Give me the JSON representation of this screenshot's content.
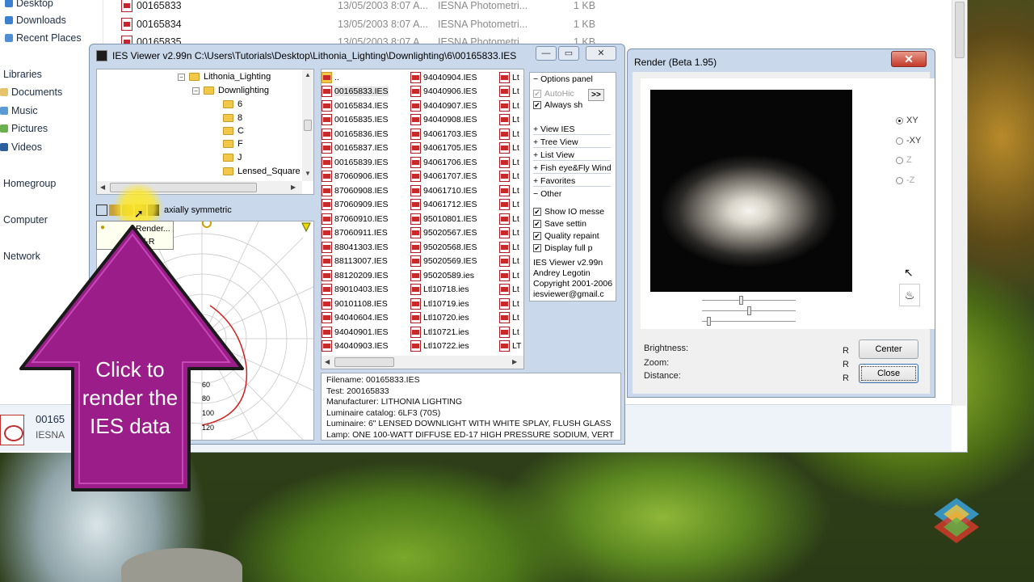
{
  "explorer": {
    "nav": [
      {
        "label": "Desktop",
        "icon": "desktop-icon"
      },
      {
        "label": "Downloads",
        "icon": "downloads-icon"
      },
      {
        "label": "Recent Places",
        "icon": "recent-places-icon"
      },
      {
        "label": "Libraries",
        "icon": "libraries-icon"
      },
      {
        "label": "Documents",
        "icon": "documents-icon"
      },
      {
        "label": "Music",
        "icon": "music-icon"
      },
      {
        "label": "Pictures",
        "icon": "pictures-icon"
      },
      {
        "label": "Videos",
        "icon": "videos-icon"
      },
      {
        "label": "Homegroup",
        "icon": "homegroup-icon"
      },
      {
        "label": "Computer",
        "icon": "computer-icon"
      },
      {
        "label": "Network",
        "icon": "network-icon"
      }
    ],
    "files": [
      {
        "name": "00165833",
        "date": "13/05/2003 8:07 A...",
        "type": "IESNA Photometri...",
        "size": "1 KB"
      },
      {
        "name": "00165834",
        "date": "13/05/2003 8:07 A...",
        "type": "IESNA Photometri...",
        "size": "1 KB"
      },
      {
        "name": "00165835",
        "date": "13/05/2003 8:07 A...",
        "type": "IESNA Photometri...",
        "size": "1 KB"
      }
    ],
    "details": {
      "name": "00165",
      "type": "IESNA"
    }
  },
  "ies_viewer": {
    "title": "IES Viewer v2.99n   C:\\Users\\Tutorials\\Desktop\\Lithonia_Lighting\\Downlighting\\6\\00165833.IES",
    "tree": [
      {
        "label": "Lithonia_Lighting",
        "level": 0,
        "expander": "-"
      },
      {
        "label": "Downlighting",
        "level": 1,
        "expander": "-"
      },
      {
        "label": "6",
        "level": 2
      },
      {
        "label": "8",
        "level": 2
      },
      {
        "label": "C",
        "level": 2
      },
      {
        "label": "F",
        "level": 2
      },
      {
        "label": "J",
        "level": 2
      },
      {
        "label": "Lensed_Square",
        "level": 2
      }
    ],
    "toolbar_text": "axially symmetric",
    "polar_labels": [
      "60",
      "80",
      "100",
      "120"
    ],
    "polar_top_left": "-5",
    "col1": [
      "..",
      "00165833.IES",
      "00165834.IES",
      "00165835.IES",
      "00165836.IES",
      "00165837.IES",
      "00165839.IES",
      "87060906.IES",
      "87060908.IES",
      "87060909.IES",
      "87060910.IES",
      "87060911.IES",
      "88041303.IES",
      "88113007.IES",
      "88120209.IES",
      "89010403.IES",
      "90101108.IES",
      "94040604.IES",
      "94040901.IES",
      "94040903.IES"
    ],
    "col2": [
      "94040904.IES",
      "94040906.IES",
      "94040907.IES",
      "94040908.IES",
      "94061703.IES",
      "94061705.IES",
      "94061706.IES",
      "94061707.IES",
      "94061710.IES",
      "94061712.IES",
      "95010801.IES",
      "95020567.IES",
      "95020568.IES",
      "95020569.IES",
      "95020589.ies",
      "Ltl10718.ies",
      "Ltl10719.ies",
      "Ltl10720.ies",
      "Ltl10721.ies",
      "Ltl10722.ies"
    ],
    "col3": [
      "Lt",
      "Lt",
      "Lt",
      "Lt",
      "Lt",
      "Lt",
      "Lt",
      "Lt",
      "Lt",
      "Lt",
      "Lt",
      "Lt",
      "Lt",
      "Lt",
      "Lt",
      "Lt",
      "Lt",
      "Lt",
      "Lt",
      "LT"
    ],
    "options": {
      "header": "Options panel",
      "autohide": "AutoHic",
      "always": "Always sh",
      "expand_btn": ">>",
      "links": [
        "+ View IES",
        "+ Tree View",
        "+ List View",
        "+ Fish eye&Fly Wind",
        "+ Favorites"
      ],
      "other_header": "Other",
      "checks": [
        "Show IO messe",
        "Save settin",
        "Quality repaint",
        "Display full p"
      ],
      "about": [
        "IES Viewer v2.99n",
        "Andrey Legotin",
        "Copyright 2001-2006",
        "iesviewer@gmail.c"
      ]
    },
    "info": [
      "Filename: 00165833.IES",
      "Test: 200165833",
      "Manufacturer: LITHONIA LIGHTING",
      "Luminaire catalog: 6LF3 (70S)",
      "Luminaire: 6\" LENSED DOWNLIGHT WITH WHITE SPLAY, FLUSH GLASS",
      "Lamp: ONE 100-WATT DIFFUSE ED-17 HIGH PRESSURE SODIUM, VERT"
    ],
    "tooltip": [
      "Render...",
      "l-R"
    ]
  },
  "render_window": {
    "title": "Render (Beta 1.95)",
    "close": "✕",
    "views": [
      "XY",
      "-XY",
      "Z",
      "-Z"
    ],
    "labels": [
      "Brightness:",
      "Zoom:",
      "Distance:"
    ],
    "r_marks": [
      "R",
      "R",
      "R"
    ],
    "center_btn": "Center",
    "close_btn": "Close"
  },
  "callout": {
    "text_lines": [
      "Click to",
      "render the",
      "IES data"
    ],
    "color": "#9b1d8a"
  }
}
